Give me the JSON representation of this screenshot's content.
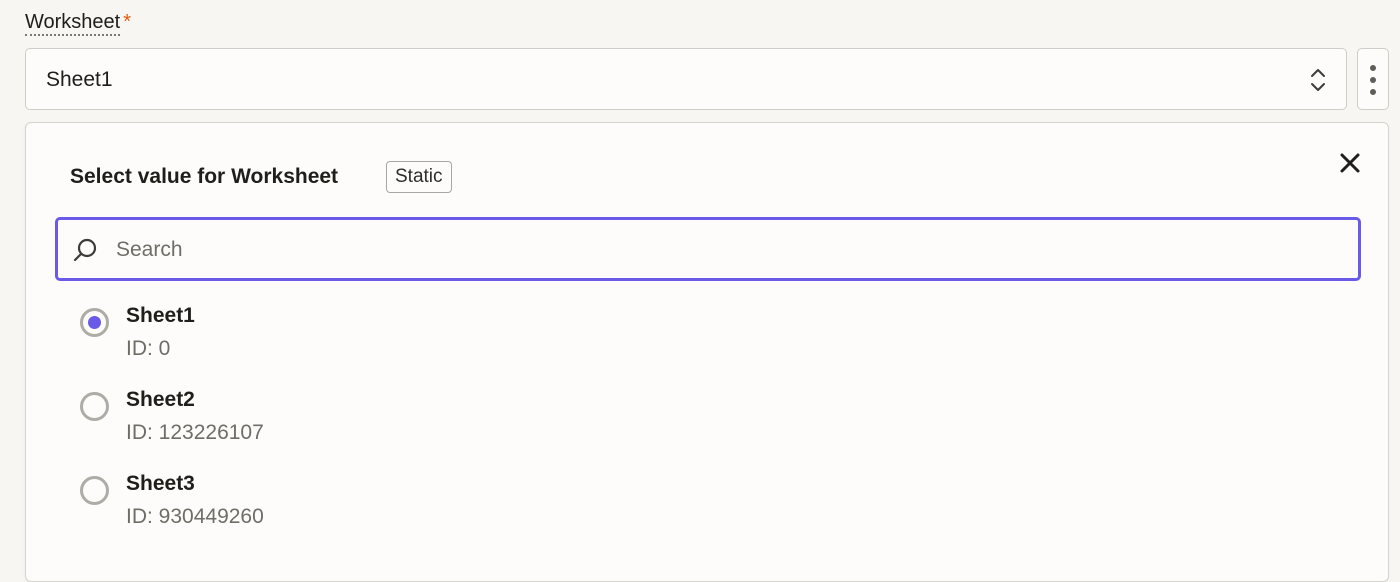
{
  "field": {
    "label": "Worksheet",
    "required_marker": "*",
    "selected_value": "Sheet1"
  },
  "panel": {
    "title": "Select value for Worksheet",
    "badge": "Static",
    "search": {
      "placeholder": "Search",
      "value": ""
    },
    "options": [
      {
        "label": "Sheet1",
        "id_text": "ID: 0",
        "selected": true
      },
      {
        "label": "Sheet2",
        "id_text": "ID: 123226107",
        "selected": false
      },
      {
        "label": "Sheet3",
        "id_text": "ID: 930449260",
        "selected": false
      }
    ]
  },
  "colors": {
    "accent": "#695be8",
    "required": "#e8590c"
  },
  "icons": {
    "select_chevron": "chevron-up-down-icon",
    "more": "more-vertical-icon",
    "close": "close-icon",
    "search": "search-icon"
  }
}
